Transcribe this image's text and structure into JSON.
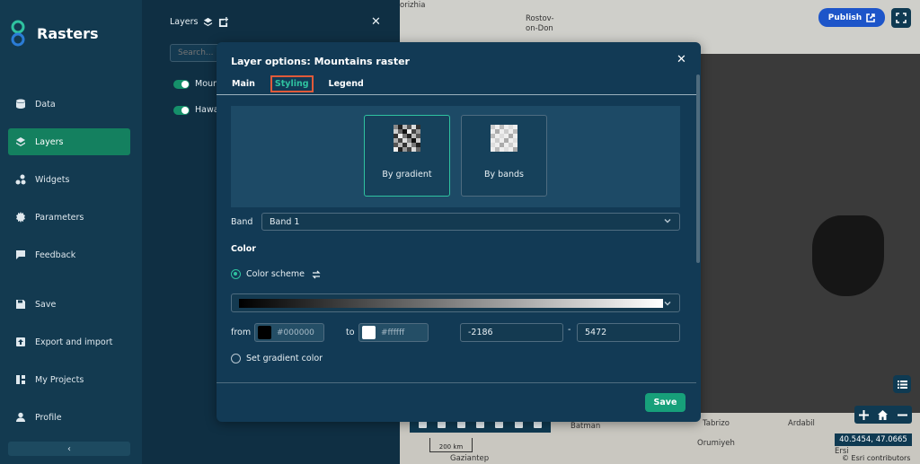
{
  "app": {
    "title": "Rasters"
  },
  "sidebar": {
    "items": [
      {
        "label": "Data",
        "icon": "database-icon"
      },
      {
        "label": "Layers",
        "icon": "layers-icon",
        "active": true
      },
      {
        "label": "Widgets",
        "icon": "widgets-icon"
      },
      {
        "label": "Parameters",
        "icon": "gear-icon"
      },
      {
        "label": "Feedback",
        "icon": "chat-icon"
      },
      {
        "label": "Save",
        "icon": "save-icon"
      },
      {
        "label": "Export and import",
        "icon": "export-icon"
      },
      {
        "label": "My Projects",
        "icon": "projects-icon"
      },
      {
        "label": "Profile",
        "icon": "user-icon"
      }
    ],
    "collapse_glyph": "‹"
  },
  "layers_panel": {
    "title": "Layers",
    "search_placeholder": "Search...",
    "layers": [
      {
        "label": "Moun"
      },
      {
        "label": "Hawa"
      }
    ]
  },
  "map": {
    "labels": [
      "orizhia",
      "Rostov-",
      "on-Don",
      "Tabrizo",
      "Ardabil",
      "Batman",
      "Orumiyeh",
      "Gaziantep",
      "Ersi"
    ],
    "publish_label": "Publish",
    "coordinates": "40.5454, 47.0665",
    "attribution": "© Esri contributors",
    "scale_label": "200 km"
  },
  "modal": {
    "title": "Layer options: Mountains raster",
    "tabs": [
      {
        "label": "Main"
      },
      {
        "label": "Styling",
        "active": true
      },
      {
        "label": "Legend"
      }
    ],
    "style_options": [
      {
        "label": "By gradient",
        "selected": true
      },
      {
        "label": "By bands",
        "selected": false
      }
    ],
    "band_label": "Band",
    "band_value": "Band 1",
    "color_section": "Color",
    "color_scheme_label": "Color scheme",
    "from_label": "from",
    "from_color": "#000000",
    "to_label": "to",
    "to_color": "#ffffff",
    "min_value": "-2186",
    "range_separator": "-",
    "max_value": "5472",
    "set_gradient_label": "Set gradient color",
    "save_label": "Save"
  },
  "colors": {
    "accent": "#14805f",
    "accent_text": "#2fc2a0",
    "publish": "#1d55c9",
    "modal_bg": "#123a55"
  }
}
